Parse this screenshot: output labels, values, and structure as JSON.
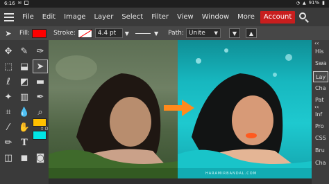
{
  "status_bar": {
    "time": "6:16",
    "battery": "91%"
  },
  "menu": {
    "items": [
      "File",
      "Edit",
      "Image",
      "Layer",
      "Select",
      "Filter",
      "View",
      "Window",
      "More"
    ],
    "account_label": "Account"
  },
  "options": {
    "fill_label": "Fill:",
    "fill_color": "#ff0000",
    "stroke_label": "Stroke:",
    "stroke_width": "4.4 pt",
    "path_label": "Path:",
    "path_mode": "Unite"
  },
  "tools": {
    "foreground_color": "#ffc000",
    "background_color": "#00e5e5"
  },
  "side_panel": {
    "tabs": [
      "His",
      "Swa",
      "Lay",
      "Cha",
      "Pat",
      "Inf",
      "Pro",
      "CSS",
      "Bru",
      "Cha"
    ],
    "active_tab": "Lay"
  },
  "canvas": {
    "watermark": "HARAMIRBANDAL.COM"
  }
}
